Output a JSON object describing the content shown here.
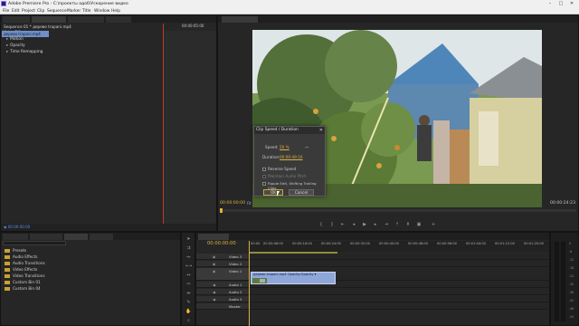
{
  "window": {
    "title": "Adobe Premiere Pro - C:\\проекты адоб\\Ускорение видео",
    "controls": [
      "–",
      "□",
      "✕"
    ]
  },
  "menu": [
    "File",
    "Edit",
    "Project",
    "Clip",
    "Sequence",
    "Marker",
    "Title",
    "Window",
    "Help"
  ],
  "effect_controls": {
    "header": "Sequence 01 * деревo trapani.mp4",
    "rows": [
      {
        "label": "Video Effects",
        "expander": ""
      },
      {
        "label": "Motion",
        "expander": "▸"
      },
      {
        "label": "Opacity",
        "expander": "▸"
      },
      {
        "label": "Time Remapping",
        "expander": "▸"
      }
    ],
    "mini_clip_label": "деревo trapani.mp4",
    "mini_timecode": "00:00:05:00",
    "footer_timecode": "◉ 00:00:00:00"
  },
  "program_monitor": {
    "timecode_left": "00:00:00:00",
    "fit_label": "Fit",
    "timecode_right": "00:00:24:23"
  },
  "clip_speed_dialog": {
    "title": "Clip Speed / Duration",
    "speed_label": "Speed:",
    "speed_value": "50 %",
    "duration_label": "Duration:",
    "duration_value": "00:00:49:16",
    "reverse_speed": "Reverse Speed",
    "maintain_audio": "Maintain Audio Pitch",
    "ripple_edit": "Ripple Edit, Shifting Trailing Clips",
    "ok": "OK",
    "cancel": "Cancel"
  },
  "project_panel": {
    "items": [
      "Presets",
      "Audio Effects",
      "Audio Transitions",
      "Video Effects",
      "Video Transitions",
      "Custom Bin 01",
      "Custom Bin 04"
    ]
  },
  "timeline": {
    "timecode": "00:00:00:00",
    "ruler_labels": [
      "00:00",
      "00:00:08:00",
      "00:00:16:00",
      "00:00:24:00",
      "00:00:32:00",
      "00:00:40:00",
      "00:00:48:00",
      "00:00:56:00",
      "00:01:04:00",
      "00:01:12:00",
      "00:01:20:00"
    ],
    "tracks": [
      "Video 3",
      "Video 2",
      "Video 1",
      "Audio 1",
      "Audio 2",
      "Audio 3",
      "Master"
    ],
    "clip_label": "деревo trapani.mp4  Opacity:Opacity ▾"
  },
  "audio_meter": {
    "scale": [
      "0",
      "-6",
      "-12",
      "-18",
      "-24",
      "-30",
      "-36",
      "-42",
      "-48",
      "-54"
    ]
  }
}
